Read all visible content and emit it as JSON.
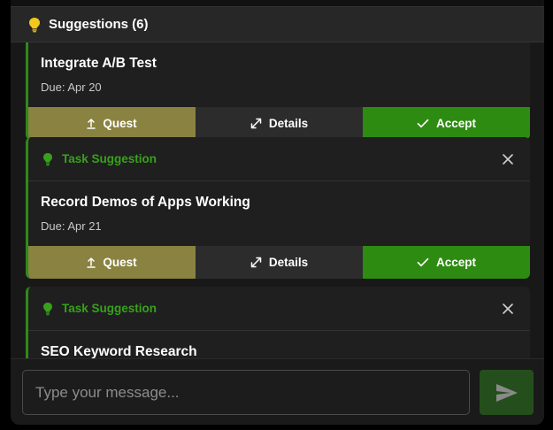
{
  "header": {
    "title": "Suggestions (6)",
    "icon": "lightbulb-icon"
  },
  "buttons": {
    "quest": "Quest",
    "details": "Details",
    "accept": "Accept"
  },
  "cards": [
    {
      "type": "Task Suggestion",
      "title": "Integrate A/B Test",
      "due": "Due: Apr 20"
    },
    {
      "type": "Task Suggestion",
      "title": "Record Demos of Apps Working",
      "due": "Due: Apr 21"
    },
    {
      "type": "Task Suggestion",
      "title": "SEO Keyword Research",
      "due": ""
    }
  ],
  "composer": {
    "placeholder": "Type your message...",
    "send_icon": "send-icon"
  },
  "colors": {
    "accent_green": "#38a11c",
    "quest_olive": "#8a8240",
    "details_gray": "#2c2c2c",
    "accept_green": "#2e8b12",
    "bulb_yellow": "#f2c81d"
  }
}
